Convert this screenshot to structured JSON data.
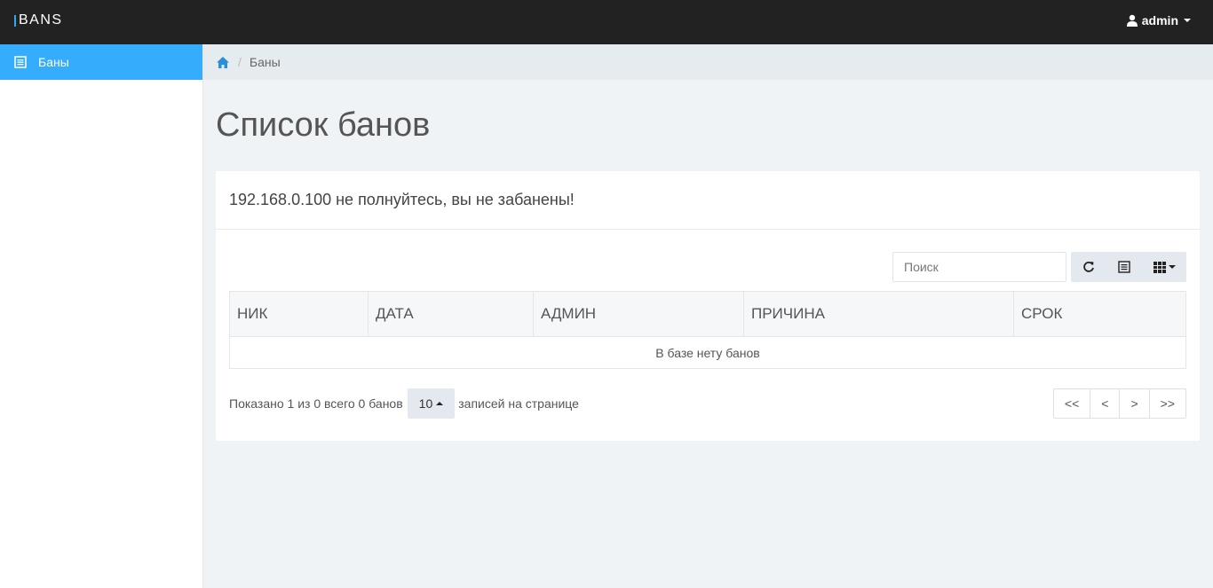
{
  "header": {
    "brand": "BANS",
    "user": "admin",
    "accent_color": "#2ea9f2"
  },
  "sidebar": {
    "items": [
      {
        "label": "Баны",
        "icon": "list-icon",
        "active": true
      }
    ],
    "active_color": "#36acfc"
  },
  "breadcrumb": {
    "home_icon": "home-icon",
    "current": "Баны",
    "separator": "/"
  },
  "page": {
    "title": "Список банов"
  },
  "panel": {
    "message": "192.168.0.100 не полнуйтесь, вы не забанены!"
  },
  "toolbar": {
    "search_placeholder": "Поиск",
    "buttons": [
      "refresh-icon",
      "list-icon",
      "columns-icon"
    ]
  },
  "table": {
    "columns": [
      "НИК",
      "ДАТА",
      "АДМИН",
      "ПРИЧИНА",
      "СРОК"
    ],
    "empty_message": "В базе нету банов"
  },
  "footer": {
    "showing": "Показано 1 из 0 всего 0 банов",
    "page_size": "10",
    "per_page_label": "записей на странице",
    "pagination": [
      "<<",
      "<",
      ">",
      ">>"
    ]
  }
}
